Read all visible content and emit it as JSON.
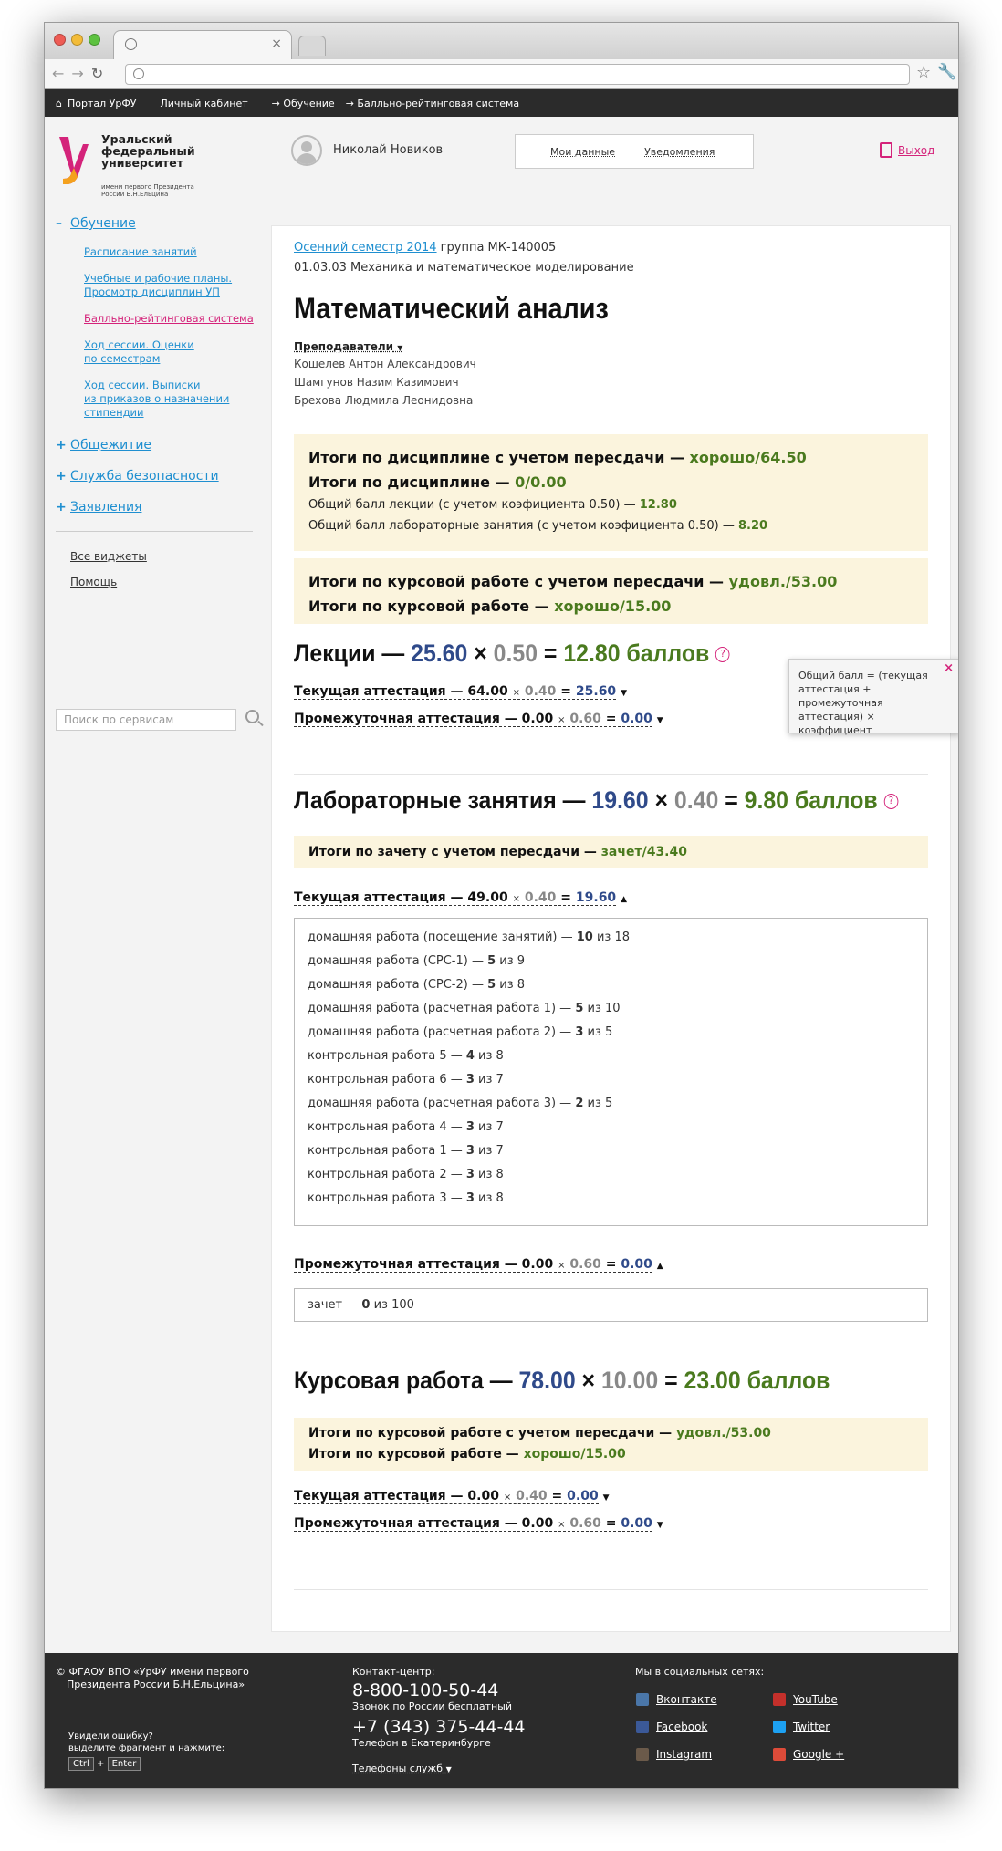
{
  "browser": {
    "tab_close": "×"
  },
  "topnav": [
    "Портал УрФУ",
    "Личный кабинет",
    "→ Обучение",
    "→ Балльно-рейтинговая система"
  ],
  "logo": {
    "line1": "Уральский",
    "line2": "федеральный",
    "line3": "университет",
    "sub1": "имени первого Президента",
    "sub2": "России Б.Н.Ельцина"
  },
  "user": {
    "name": "Николай Новиков",
    "my_data": "Мои данные",
    "notifications": "Уведомления",
    "exit": "Выход"
  },
  "sidebar": {
    "learning": "Обучение",
    "learning_pm": "–",
    "subs": [
      "Расписание занятий",
      "Учебные и рабочие планы.",
      "Просмотр дисциплин УП",
      "Балльно-рейтинговая система",
      "Ход сессии. Оценки",
      "по семестрам",
      "Ход сессии. Выписки",
      "из приказов о назначении",
      "стипендии"
    ],
    "dorm": "Общежитие",
    "security": "Служба безопасности",
    "apps": "Заявления",
    "plus": "+",
    "all_widgets": "Все виджеты",
    "help": "Помощь",
    "search_placeholder": "Поиск по сервисам"
  },
  "main": {
    "semester": "Осенний семестр 2014",
    "group": " группа МК-140005",
    "spec": "01.03.03  Механика и математическое моделирование",
    "title": "Математический анализ",
    "teachers_label": "Преподаватели",
    "teachers": [
      "Кошелев Антон Александрович",
      "Шамгунов Назим Казимович",
      "Брехова Людмила Леонидовна"
    ],
    "summary": {
      "l1": "Итоги по дисциплине с учетом пересдачи — ",
      "v1": "хорошо/64.50",
      "l2": "Итоги по дисциплине — ",
      "v2": "0/0.00",
      "l3": "Общий балл лекции (с учетом коэфициента 0.50) — ",
      "v3": "12.80",
      "l4": "Общий балл лабораторные занятия  (с учетом коэфициента 0.50) — ",
      "v4": "8.20"
    },
    "course_summary": {
      "l1": "Итоги по курсовой работе с учетом пересдачи — ",
      "v1": "удовл./53.00",
      "l2": "Итоги по курсовой работе — ",
      "v2": "хорошо/15.00"
    },
    "lectures": {
      "name": "Лекции — ",
      "score": "25.60",
      "coef": "0.50",
      "total": "12.80 баллов",
      "current": {
        "label": "Текущая аттестация — ",
        "score": "64.00",
        "coef": "0.40",
        "eq": "25.60"
      },
      "interim": {
        "label": "Промежуточная аттестация — ",
        "score": "0.00",
        "coef": "0.60",
        "eq": "0.00"
      }
    },
    "tooltip": "Общий балл = (текущая аттестация + промежуточная аттестация) × коэффициент",
    "labs": {
      "name": "Лабораторные занятия — ",
      "score": "19.60",
      "coef": "0.40",
      "total": "9.80 баллов",
      "exam_label": "Итоги по зачету с учетом пересдачи — ",
      "exam_value": "зачет/43.40",
      "current": {
        "label": "Текущая аттестация — ",
        "score": "49.00",
        "coef": "0.40",
        "eq": "19.60"
      },
      "items": [
        {
          "name": "домашняя работа (посещение занятий) — ",
          "got": "10",
          "max": " из 18"
        },
        {
          "name": "домашняя работа (СРС-1) — ",
          "got": "5",
          "max": " из 9"
        },
        {
          "name": "домашняя работа (СРС-2) — ",
          "got": "5",
          "max": " из 8"
        },
        {
          "name": "домашняя работа (расчетная работа 1) — ",
          "got": "5",
          "max": " из 10"
        },
        {
          "name": "домашняя работа (расчетная работа 2) — ",
          "got": "3",
          "max": " из 5"
        },
        {
          "name": "контрольная работа 5 — ",
          "got": "4",
          "max": " из 8"
        },
        {
          "name": "контрольная работа 6 — ",
          "got": "3",
          "max": " из 7"
        },
        {
          "name": "домашняя работа (расчетная работа 3) — ",
          "got": "2",
          "max": " из 5"
        },
        {
          "name": "контрольная работа 4 — ",
          "got": "3",
          "max": " из 7"
        },
        {
          "name": "контрольная работа 1 — ",
          "got": "3",
          "max": " из 7"
        },
        {
          "name": "контрольная работа 2 — ",
          "got": "3",
          "max": " из 8"
        },
        {
          "name": "контрольная работа 3 — ",
          "got": "3",
          "max": " из 8"
        }
      ],
      "interim": {
        "label": "Промежуточная аттестация — ",
        "score": "0.00",
        "coef": "0.60",
        "eq": "0.00"
      },
      "interim_item": {
        "name": "зачет — ",
        "got": "0",
        "max": " из 100"
      }
    },
    "coursework": {
      "name": "Курсовая работа — ",
      "score": "78.00",
      "coef": "10.00",
      "total": "23.00 баллов",
      "l1": "Итоги по курсовой работе с учетом пересдачи — ",
      "v1": "удовл./53.00",
      "l2": "Итоги по курсовой работе — ",
      "v2": "хорошо/15.00",
      "current": {
        "label": "Текущая аттестация — ",
        "score": "0.00",
        "coef": "0.40",
        "eq": "0.00"
      },
      "interim": {
        "label": "Промежуточная аттестация — ",
        "score": "0.00",
        "coef": "0.60",
        "eq": "0.00"
      }
    },
    "times": "×",
    "small_times": "×",
    "equals": "=",
    "qmark": "?"
  },
  "footer": {
    "copy1": "© ФГАОУ ВПО «УрФУ имени первого",
    "copy2": "Президента России Б.Н.Ельцина»",
    "err1": "Увидели ошибку?",
    "err2": "выделите фрагмент и нажмите:",
    "ctrl": "Ctrl",
    "plus": "+",
    "enter": "Enter",
    "contact": "Контакт-центр:",
    "phone1": "8-800-100-50-44",
    "phone1_note": "Звонок по России бесплатный",
    "phone2": "+7 (343) 375-44-44",
    "phone2_note": "Телефон в Екатеринбурге",
    "services": "Телефоны служб",
    "social": "Мы в социальных сетях:",
    "vk": "Вконтакте",
    "youtube": "YouTube",
    "facebook": "Facebook",
    "twitter": "Twitter",
    "instagram": "Instagram",
    "gplus": "Google +"
  },
  "colors": {
    "accent": "#1f8fd0",
    "pink": "#d4237a",
    "green": "#4a7a1e",
    "blue": "#2f4a8a",
    "box": "#fbf4dd"
  }
}
